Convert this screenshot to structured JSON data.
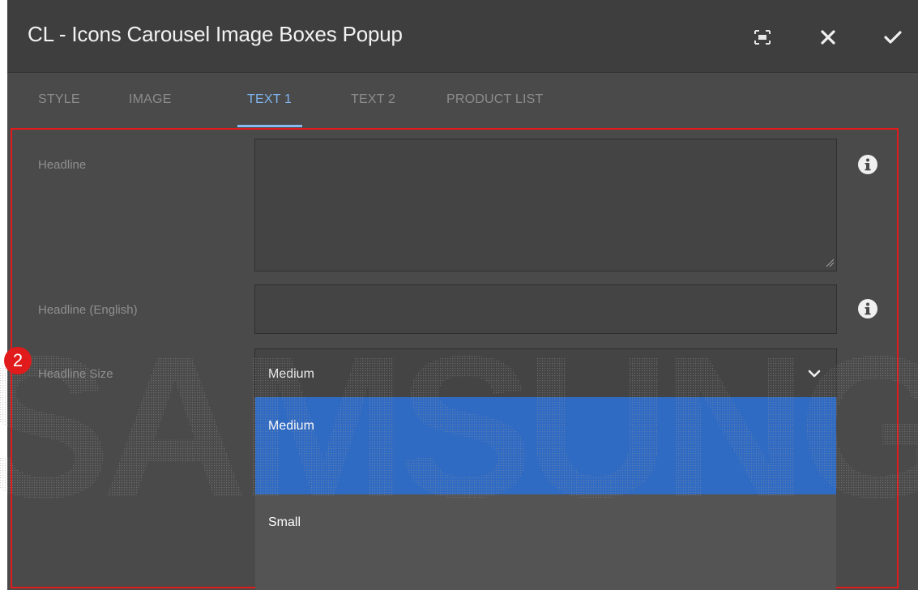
{
  "dialog": {
    "title": "CL - Icons Carousel Image Boxes Popup",
    "header_icons": [
      "fullscreen-icon",
      "close-icon",
      "check-icon"
    ]
  },
  "tabs": [
    {
      "label": "STYLE",
      "active": false
    },
    {
      "label": "IMAGE",
      "active": false
    },
    {
      "label": "TEXT 1",
      "active": true
    },
    {
      "label": "TEXT 2",
      "active": false
    },
    {
      "label": "PRODUCT LIST",
      "active": false
    }
  ],
  "fields": {
    "headline": {
      "label": "Headline",
      "value": ""
    },
    "headline_english": {
      "label": "Headline (English)",
      "value": ""
    },
    "headline_size": {
      "label": "Headline Size",
      "selected": "Medium",
      "options": [
        "Medium",
        "Small"
      ]
    }
  },
  "annotation": {
    "badge": "2"
  },
  "watermark": "SAMSUNG",
  "colors": {
    "accent": "#8ab9ee",
    "selection": "#2f6ac3",
    "annotation_red": "#e11b1b",
    "dialog_bg": "#4a4a4a",
    "header_bg": "#3e3e3e"
  }
}
